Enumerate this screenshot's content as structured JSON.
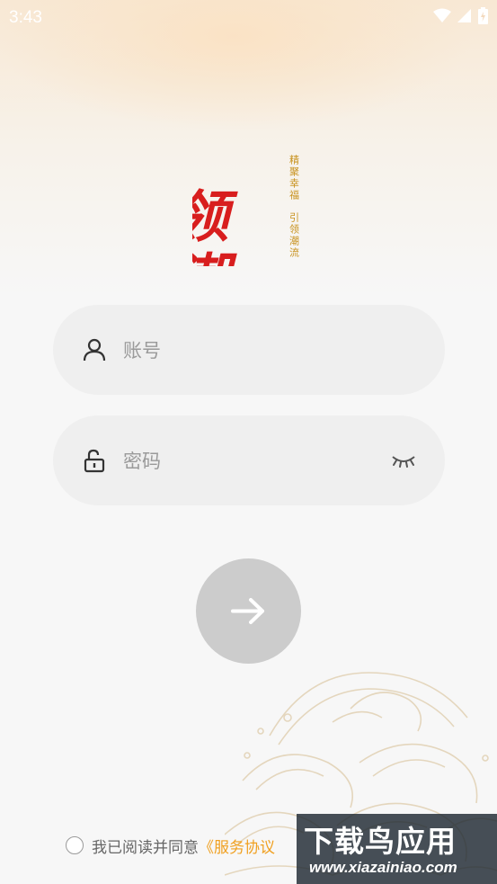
{
  "status_bar": {
    "time": "3:43"
  },
  "branding": {
    "logo_text": "领潮",
    "slogan_line1": "精聚幸福",
    "slogan_line2": "引领潮流",
    "logo_color": "#d81e1e",
    "slogan_color": "#c8921e"
  },
  "form": {
    "account_placeholder": "账号",
    "account_value": "",
    "password_placeholder": "密码",
    "password_value": ""
  },
  "submit_icon": "arrow-right-icon",
  "agreement": {
    "prefix": "我已阅读并同意",
    "link": "《服务协议",
    "checked": false,
    "link_color": "#f0a020"
  },
  "watermark": {
    "title": "下载鸟应用",
    "url": "www.xiazainiao.com"
  }
}
